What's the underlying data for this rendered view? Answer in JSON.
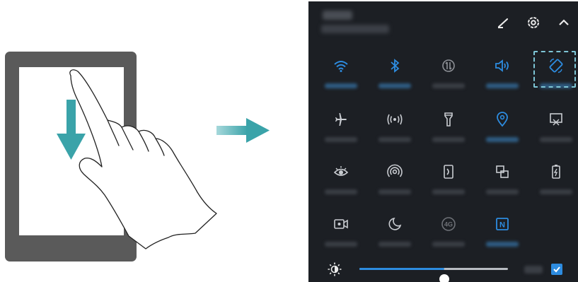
{
  "colors": {
    "panel_bg": "#1c1f24",
    "accent_blue": "#2d8ce0",
    "icon_gray": "#c9ccd1",
    "arrow_teal": "#3aa3a9",
    "highlight_dashed": "#7ec6d6"
  },
  "illustration": {
    "gesture": "swipe-down-from-top",
    "icons": [
      "phone",
      "down-arrow",
      "hand-pointer",
      "right-arrow"
    ]
  },
  "panel": {
    "header_icons": [
      "edit-icon",
      "settings-icon",
      "collapse-chevron-icon"
    ],
    "tiles": [
      {
        "id": "wifi",
        "icon": "wifi-icon",
        "active": true
      },
      {
        "id": "bluetooth",
        "icon": "bluetooth-icon",
        "active": true
      },
      {
        "id": "mobile-data",
        "icon": "mobile-data-icon",
        "active": false
      },
      {
        "id": "sound",
        "icon": "sound-icon",
        "active": true
      },
      {
        "id": "auto-rotate",
        "icon": "rotate-icon",
        "active": true,
        "highlighted": true
      },
      {
        "id": "airplane-mode",
        "icon": "airplane-icon",
        "active": false
      },
      {
        "id": "hotspot",
        "icon": "hotspot-icon",
        "active": false
      },
      {
        "id": "flashlight",
        "icon": "flashlight-icon",
        "active": false
      },
      {
        "id": "location",
        "icon": "location-icon",
        "active": true
      },
      {
        "id": "screenshot",
        "icon": "screenshot-icon",
        "active": false
      },
      {
        "id": "eye-comfort",
        "icon": "eye-icon",
        "active": false
      },
      {
        "id": "huawei-share",
        "icon": "share-icon",
        "active": false
      },
      {
        "id": "screen-mirror",
        "icon": "mirror-icon",
        "active": false
      },
      {
        "id": "multi-screen",
        "icon": "multiscreen-icon",
        "active": false
      },
      {
        "id": "battery-saver",
        "icon": "battery-icon",
        "active": false
      },
      {
        "id": "screen-recorder",
        "icon": "recorder-icon",
        "active": false
      },
      {
        "id": "do-not-disturb",
        "icon": "moon-icon",
        "active": false
      },
      {
        "id": "4g",
        "icon": "4g-icon",
        "active": false,
        "text": "4G"
      },
      {
        "id": "nfc",
        "icon": "nfc-icon",
        "active": true,
        "text": "N"
      }
    ],
    "brightness": {
      "icon": "brightness-icon",
      "level_fraction": 0.57,
      "auto_checked": true
    }
  }
}
